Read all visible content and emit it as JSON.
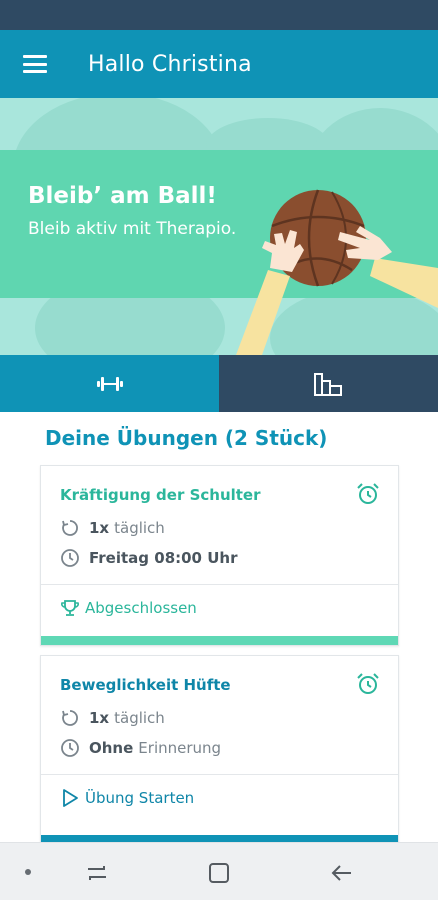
{
  "app_bar": {
    "title": "Hallo Christina",
    "menu_icon": "hamburger-menu-icon"
  },
  "hero": {
    "title": "Bleib’ am Ball!",
    "subtitle": "Bleib aktiv mit Therapio.",
    "colors": {
      "band": "#5fd6b0",
      "background": "#a9e6dc",
      "ball": "#8a4e2f"
    }
  },
  "tabs": [
    {
      "icon": "dumbbell-icon",
      "active": true
    },
    {
      "icon": "bar-chart-icon",
      "active": false
    }
  ],
  "section": {
    "title": "Deine Übungen (2 Stück)"
  },
  "exercises": [
    {
      "name": "Kräftigung der Schulter",
      "frequency_bold": "1x",
      "frequency_text": "täglich",
      "reminder_bold": "Freitag 08:00 Uhr",
      "reminder_text": "",
      "action": "Abgeschlossen",
      "action_icon": "trophy-icon",
      "accent": "#5fd8b5"
    },
    {
      "name": "Beweglichkeit Hüfte",
      "frequency_bold": "1x",
      "frequency_text": "täglich",
      "reminder_bold": "Ohne",
      "reminder_text": "Erinnerung",
      "action": "Übung Starten",
      "action_icon": "play-icon",
      "accent": "#0f93b6"
    }
  ],
  "colors": {
    "primary": "#0f93b6",
    "dark": "#2f4a63",
    "status_bar": "#2f4a63"
  }
}
